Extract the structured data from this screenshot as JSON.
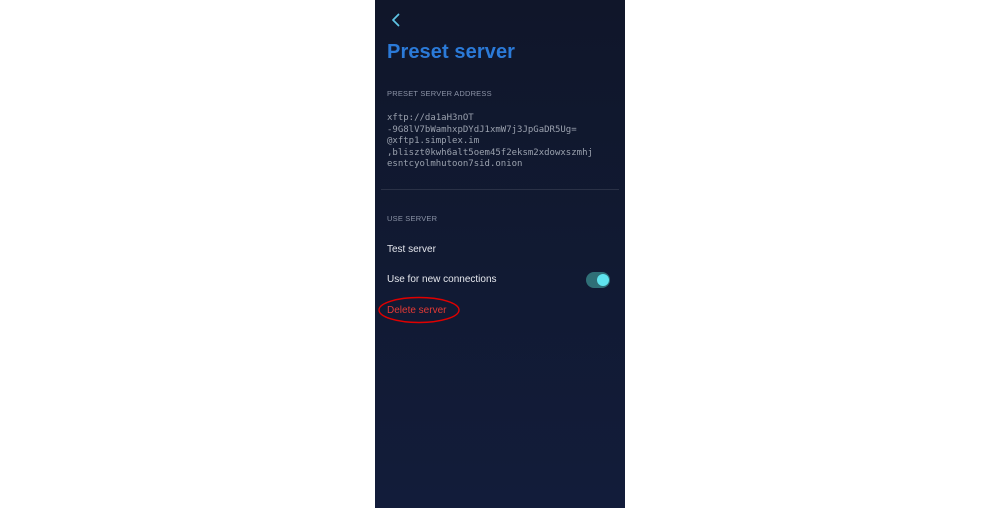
{
  "header": {
    "title": "Preset server"
  },
  "preset_section": {
    "label": "PRESET SERVER ADDRESS",
    "address_lines": [
      "xftp://da1aH3nOT",
      "-9G8lV7bWamhxpDYdJ1xmW7j3JpGaDR5Ug=",
      "@xftp1.simplex.im",
      ",bliszt0kwh6alt5oem45f2eksm2xdowxszmhj",
      "esntcyolmhutoon7sid.onion"
    ]
  },
  "use_section": {
    "label": "USE SERVER",
    "test_server": "Test server",
    "use_new_connections": "Use for new connections",
    "use_new_connections_enabled": true,
    "delete_server": "Delete server"
  },
  "colors": {
    "title": "#2b7ad8",
    "toggle_track": "#2f6f77",
    "toggle_knob": "#5fe3ee",
    "delete": "#e53935",
    "annotation": "#e00000"
  },
  "icons": {
    "back": "chevron-left-icon"
  }
}
